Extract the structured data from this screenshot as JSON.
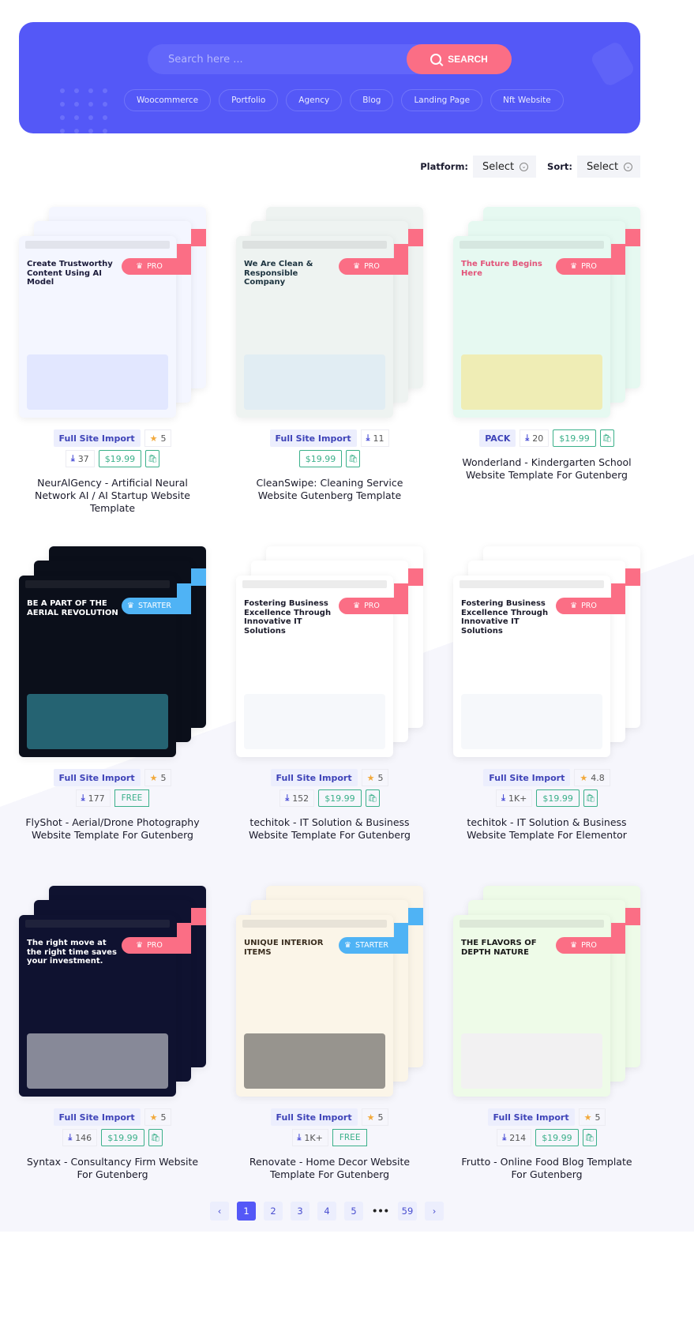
{
  "search": {
    "placeholder": "Search here ...",
    "button_label": "SEARCH",
    "chips": [
      "Woocommerce",
      "Portfolio",
      "Agency",
      "Blog",
      "Landing Page",
      "Nft Website"
    ]
  },
  "filters": {
    "platform_label": "Platform:",
    "platform_value": "Select",
    "sort_label": "Sort:",
    "sort_value": "Select"
  },
  "colors": {
    "hero": "#5458f7",
    "search_button": "#fb6e85",
    "pro": "#fb6e85",
    "starter": "#4fb3f5",
    "price": "#3bb08a",
    "tag_bg": "#eceefd"
  },
  "templates": [
    {
      "title": "NeurAlGency - Artificial Neural Network AI / AI Startup Website Template",
      "tag": "Full Site Import",
      "rating": "5",
      "downloads": "37",
      "price": "$19.99",
      "ribbon": "PRO",
      "preview_headline": "Create Trustworthy Content Using AI Model",
      "preview_bg": "#f4f6ff",
      "preview_accent": "#cfd8ff",
      "preview_text": "#1b1b3a"
    },
    {
      "title": "CleanSwipe: Cleaning Service Website Gutenberg Template",
      "tag": "Full Site Import",
      "downloads": "11",
      "price": "$19.99",
      "ribbon": "PRO",
      "preview_headline": "We Are Clean & Responsible Company",
      "preview_bg": "#eef3f1",
      "preview_accent": "#d4e8f5",
      "preview_text": "#1d3440"
    },
    {
      "title": "Wonderland - Kindergarten School Website Template For Gutenberg",
      "tag": "PACK",
      "downloads": "20",
      "price": "$19.99",
      "ribbon": "PRO",
      "preview_headline": "The Future Begins Here",
      "preview_bg": "#e6f9f1",
      "preview_accent": "#f7e27a",
      "preview_text": "#e2557a"
    },
    {
      "title": "FlyShot - Aerial/Drone Photography Website Template For Gutenberg",
      "tag": "Full Site Import",
      "rating": "5",
      "downloads": "177",
      "free": "FREE",
      "ribbon": "STARTER",
      "preview_headline": "BE A PART OF THE AERIAL REVOLUTION",
      "preview_bg": "#0b0f1a",
      "preview_accent": "#3fb7c9",
      "preview_text": "#ffffff"
    },
    {
      "title": "techitok - IT Solution & Business Website Template For Gutenberg",
      "tag": "Full Site Import",
      "rating": "5",
      "downloads": "152",
      "price": "$19.99",
      "ribbon": "PRO",
      "preview_headline": "Fostering Business Excellence Through Innovative IT Solutions",
      "preview_bg": "#ffffff",
      "preview_accent": "#eef1f7",
      "preview_text": "#1c1c2c"
    },
    {
      "title": "techitok - IT Solution & Business Website Template For Elementor",
      "tag": "Full Site Import",
      "rating": "4.8",
      "downloads": "1K+",
      "price": "$19.99",
      "ribbon": "PRO",
      "preview_headline": "Fostering Business Excellence Through Innovative IT Solutions",
      "preview_bg": "#ffffff",
      "preview_accent": "#eef1f7",
      "preview_text": "#1c1c2c"
    },
    {
      "title": "Syntax - Consultancy Firm Website For Gutenberg",
      "tag": "Full Site Import",
      "rating": "5",
      "downloads": "146",
      "price": "$19.99",
      "ribbon": "PRO",
      "preview_headline": "The right move at the right time saves your investment.",
      "preview_bg": "#0f1230",
      "preview_accent": "#ffffff",
      "preview_text": "#ffffff"
    },
    {
      "title": "Renovate - Home Decor Website Template For Gutenberg",
      "tag": "Full Site Import",
      "rating": "5",
      "downloads": "1K+",
      "free": "FREE",
      "ribbon": "STARTER",
      "preview_headline": "UNIQUE INTERIOR ITEMS",
      "preview_bg": "#fbf5e8",
      "preview_accent": "#333333",
      "preview_text": "#3a2d1e"
    },
    {
      "title": "Frutto - Online Food Blog Template For Gutenberg",
      "tag": "Full Site Import",
      "rating": "5",
      "downloads": "214",
      "price": "$19.99",
      "ribbon": "PRO",
      "preview_headline": "THE FLAVORS OF DEPTH NATURE",
      "preview_bg": "#eefbe8",
      "preview_accent": "#f6e8fb",
      "preview_text": "#1a1a1a"
    }
  ],
  "pagination": {
    "pages": [
      "1",
      "2",
      "3",
      "4",
      "5"
    ],
    "ellipsis": "•••",
    "last": "59",
    "current": "1",
    "prev": "‹",
    "next": "›"
  }
}
